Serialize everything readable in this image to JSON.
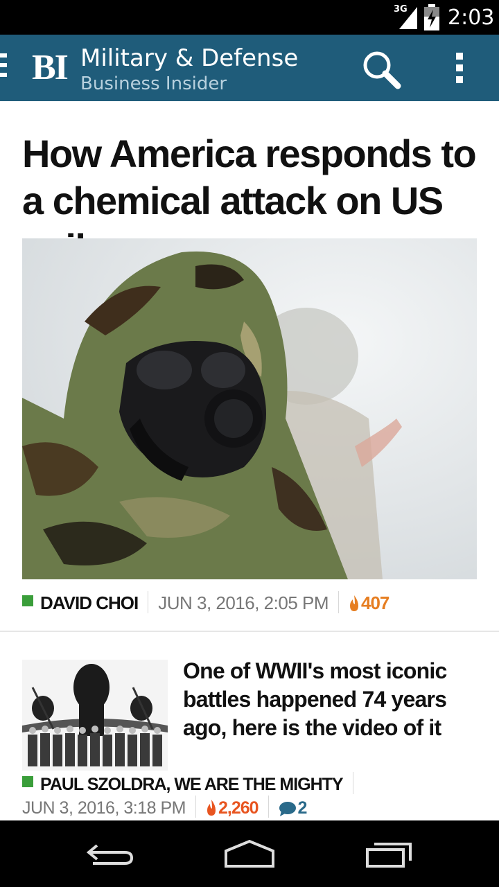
{
  "status_bar": {
    "network": "3G",
    "time": "2:03"
  },
  "app_bar": {
    "logo": "BI",
    "title": "Military & Defense",
    "subtitle": "Business Insider",
    "icons": [
      "drawer-icon",
      "search-icon",
      "overflow-menu-icon"
    ],
    "color": "#1f5c7a"
  },
  "lead_story": {
    "headline": "How America responds to a chemical attack on US soil",
    "author": "DAVID CHOI",
    "date": "JUN 3, 2016, 2:05 PM",
    "views": "407"
  },
  "story_2": {
    "headline": "One of WWII's most iconic battles happened 74 years ago, here is the video of it",
    "author": "PAUL SZOLDRA, WE ARE THE MIGHTY",
    "date": "JUN 3, 2016, 3:18 PM",
    "views": "2,260",
    "comments": "2"
  },
  "nav_bar": {
    "icons": [
      "back-icon",
      "home-icon",
      "recents-icon"
    ]
  },
  "colors": {
    "author_marker": "#3a9e3a",
    "views": "#e67e22",
    "views_hot": "#e85520",
    "comments": "#2a6a8a"
  }
}
